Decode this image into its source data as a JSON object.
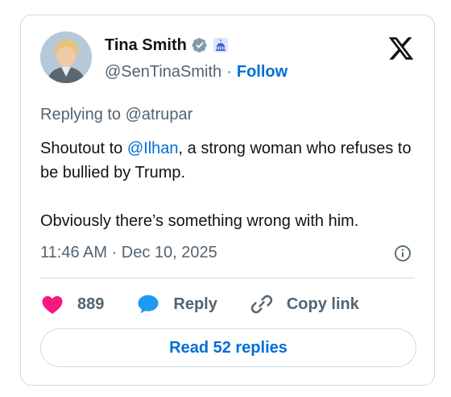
{
  "author": {
    "name": "Tina Smith",
    "handle": "@SenTinaSmith",
    "separator": "·",
    "follow_label": "Follow"
  },
  "tweet": {
    "reply_prefix": "Replying to ",
    "reply_to": "@atrupar",
    "text_before_mention": "Shoutout to ",
    "mention": "@Ilhan",
    "text_after_mention": ", a strong woman who refuses to be bullied by Trump.\n\nObviously there’s something wrong with him.",
    "timestamp": "11:46 AM · Dec 10, 2025"
  },
  "actions": {
    "like_count": "889",
    "reply_label": "Reply",
    "copy_link_label": "Copy link"
  },
  "read_replies_label": "Read 52 replies",
  "colors": {
    "accent": "#006fd6",
    "like": "#f91880",
    "reply_icon": "#1d9bf0",
    "verified": "#829aab",
    "text_secondary": "#536471"
  },
  "icons": [
    "verified-badge-icon",
    "government-capitol-icon",
    "x-logo-icon",
    "info-icon",
    "heart-icon",
    "reply-bubble-icon",
    "link-icon"
  ]
}
